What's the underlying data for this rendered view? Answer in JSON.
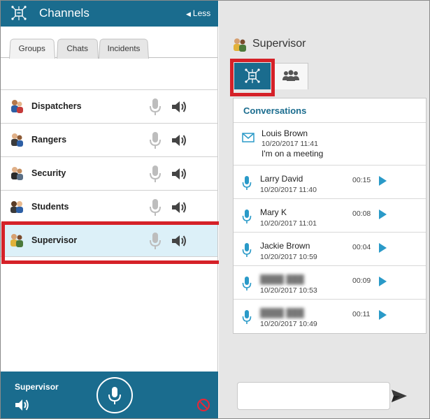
{
  "header": {
    "title": "Channels",
    "less_label": "Less",
    "app_icon": "channels-icon"
  },
  "left_tabs": [
    {
      "label": "Groups",
      "active": true
    },
    {
      "label": "Chats",
      "active": false
    },
    {
      "label": "Incidents",
      "active": false
    }
  ],
  "channels": [
    {
      "label": "Dispatchers",
      "selected": false
    },
    {
      "label": "Rangers",
      "selected": false
    },
    {
      "label": "Security",
      "selected": false
    },
    {
      "label": "Students",
      "selected": false
    },
    {
      "label": "Supervisor",
      "selected": true
    }
  ],
  "bottom_bar": {
    "active_channel": "Supervisor",
    "icons": [
      "speaker-icon",
      "microphone-icon",
      "blocked-icon"
    ]
  },
  "right_panel": {
    "title": "Supervisor",
    "tabs": [
      {
        "icon": "channels-icon",
        "active": true
      },
      {
        "icon": "people-icon",
        "active": false
      }
    ],
    "conversations_title": "Conversations",
    "text_message": {
      "from": "Louis Brown",
      "time": "10/20/2017 11:41",
      "body": "I'm on a meeting"
    },
    "audio_messages": [
      {
        "from": "Larry David",
        "time": "10/20/2017 11:40",
        "duration": "00:15",
        "blurred": false
      },
      {
        "from": "Mary K",
        "time": "10/20/2017 11:01",
        "duration": "00:08",
        "blurred": false
      },
      {
        "from": "Jackie Brown",
        "time": "10/20/2017 10:59",
        "duration": "00:04",
        "blurred": false
      },
      {
        "from": "",
        "time": "10/20/2017 10:53",
        "duration": "00:09",
        "blurred": true
      },
      {
        "from": "",
        "time": "10/20/2017 10:49",
        "duration": "00:11",
        "blurred": true
      }
    ]
  },
  "colors": {
    "brand": "#1a6c8e",
    "highlight": "#d52128",
    "selected_row": "#dcf0f8",
    "accent": "#2a9ac8"
  }
}
